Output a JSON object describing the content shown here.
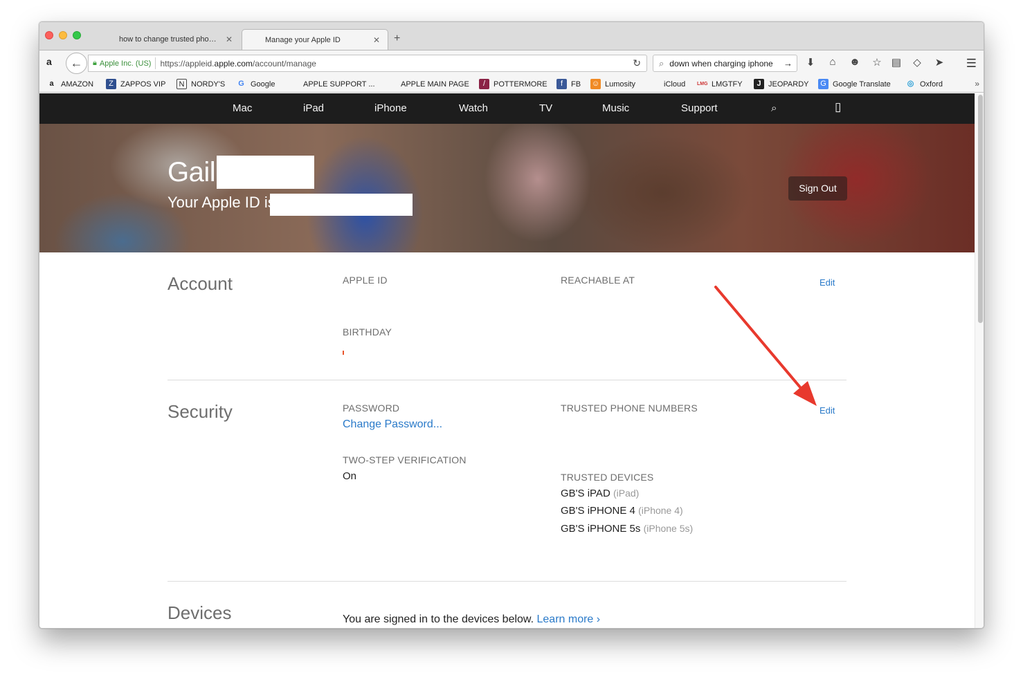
{
  "browser": {
    "tabs": [
      {
        "title": "how to change trusted pho…",
        "favicon": "apple-icon"
      },
      {
        "title": "Manage your Apple ID",
        "favicon": "apple-icon"
      }
    ],
    "url_org": "Apple Inc. (US)",
    "url_prefix": "https://appleid.",
    "url_domain": "apple.com",
    "url_path": "/account/manage",
    "search_query": "down when charging iphone",
    "bookmarks": [
      {
        "label": "AMAZON",
        "icon": "amazon-icon"
      },
      {
        "label": "ZAPPOS VIP",
        "icon": "zappos-icon"
      },
      {
        "label": "NORDY'S",
        "icon": "nordstrom-icon"
      },
      {
        "label": "Google",
        "icon": "google-icon"
      },
      {
        "label": "APPLE SUPPORT ...",
        "icon": "apple-icon"
      },
      {
        "label": "APPLE MAIN PAGE",
        "icon": "apple-icon"
      },
      {
        "label": "POTTERMORE",
        "icon": "pottermore-icon"
      },
      {
        "label": "FB",
        "icon": "facebook-icon"
      },
      {
        "label": "Lumosity",
        "icon": "lumosity-icon"
      },
      {
        "label": "iCloud",
        "icon": "apple-icon"
      },
      {
        "label": "LMGTFY",
        "icon": "lmgtfy-icon"
      },
      {
        "label": "JEOPARDY",
        "icon": "jeopardy-icon"
      },
      {
        "label": "Google Translate",
        "icon": "translate-icon"
      },
      {
        "label": "Oxford",
        "icon": "oxford-icon"
      }
    ]
  },
  "globalnav": {
    "items": [
      "Mac",
      "iPad",
      "iPhone",
      "Watch",
      "TV",
      "Music",
      "Support"
    ]
  },
  "hero": {
    "first_name": "Gail",
    "apple_id_prefix": "Your Apple ID is",
    "sign_out": "Sign Out"
  },
  "account": {
    "title": "Account",
    "apple_id_label": "APPLE ID",
    "reachable_label": "REACHABLE AT",
    "birthday_label": "BIRTHDAY",
    "edit": "Edit"
  },
  "security": {
    "title": "Security",
    "password_label": "PASSWORD",
    "change_password": "Change Password...",
    "two_step_label": "TWO-STEP VERIFICATION",
    "two_step_value": "On",
    "trusted_numbers_label": "TRUSTED PHONE NUMBERS",
    "trusted_devices_label": "TRUSTED DEVICES",
    "devices": [
      {
        "name": "GB'S iPAD",
        "model": "(iPad)"
      },
      {
        "name": "GB'S iPHONE 4",
        "model": "(iPhone 4)"
      },
      {
        "name": "GB'S iPHONE 5s",
        "model": "(iPhone 5s)"
      }
    ],
    "edit": "Edit"
  },
  "devices": {
    "title": "Devices",
    "text": "You are signed in to the devices below.",
    "learn_more": "Learn more ›"
  },
  "colors": {
    "link": "#2a7ac9",
    "annotation_arrow": "#e8392d",
    "nav_bg": "#1d1d1d"
  }
}
